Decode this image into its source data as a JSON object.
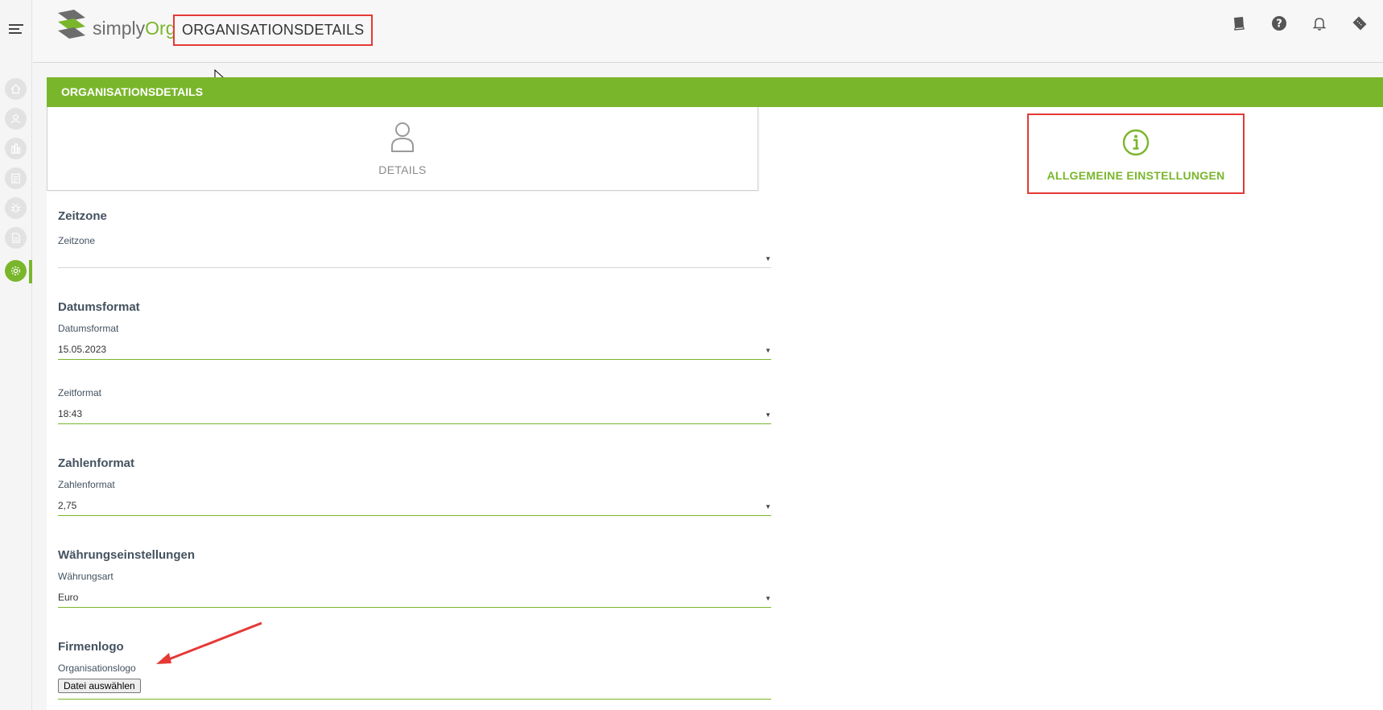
{
  "app": {
    "logo_simply": "simply",
    "logo_org": "Org"
  },
  "header": {
    "page_title": "ORGANISATIONSDETAILS",
    "icons": [
      "book-icon",
      "help-icon",
      "bell-icon",
      "ticket-icon"
    ]
  },
  "sidebar": {
    "items": [
      "home-icon",
      "users-icon",
      "buildings-icon",
      "tasks-icon",
      "bug-icon",
      "document-icon",
      "settings-icon"
    ],
    "active": "settings-icon"
  },
  "panel": {
    "title": "ORGANISATIONSDETAILS",
    "tabs": [
      {
        "label": "DETAILS",
        "icon": "user-icon"
      },
      {
        "label": "ALLGEMEINE EINSTELLUNGEN",
        "icon": "info-icon",
        "active": true
      }
    ]
  },
  "form": {
    "zeitzone": {
      "section": "Zeitzone",
      "label": "Zeitzone",
      "value": ""
    },
    "datumsformat": {
      "section": "Datumsformat",
      "label": "Datumsformat",
      "value": "15.05.2023"
    },
    "zeitformat": {
      "label": "Zeitformat",
      "value": "18:43"
    },
    "zahlenformat": {
      "section": "Zahlenformat",
      "label": "Zahlenformat",
      "value": "2,75"
    },
    "waehrung": {
      "section": "Währungseinstellungen",
      "label": "Währungsart",
      "value": "Euro"
    },
    "logo": {
      "section": "Firmenlogo",
      "label": "Organisationslogo",
      "button": "Datei auswählen"
    }
  },
  "colors": {
    "accent": "#7ab62c",
    "highlight": "#e53935"
  }
}
